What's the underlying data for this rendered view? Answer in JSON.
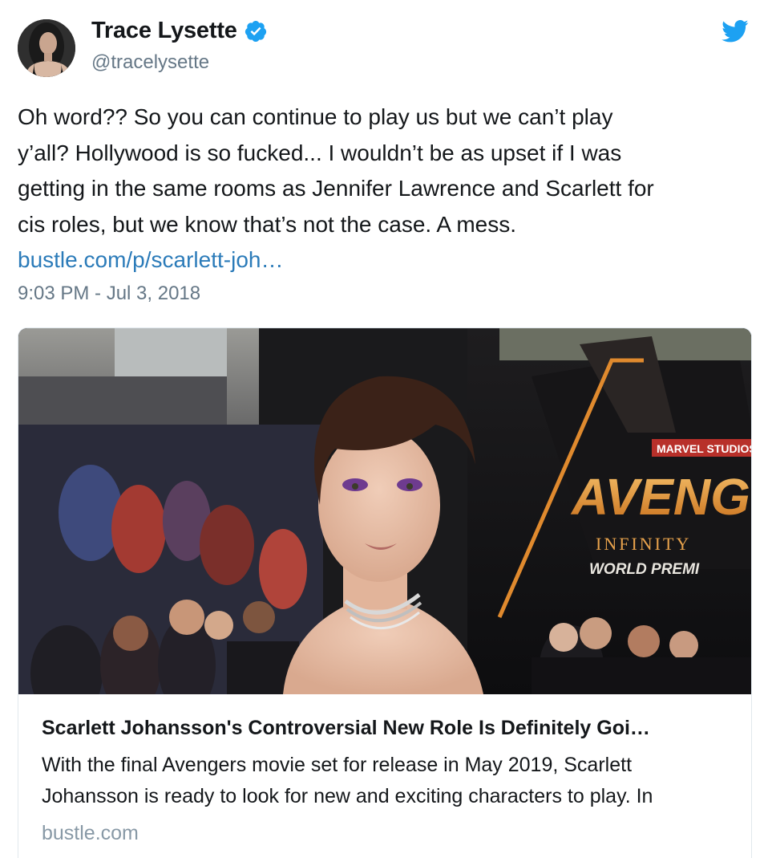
{
  "author": {
    "display_name": "Trace Lysette",
    "handle": "@tracelysette",
    "verified": true,
    "avatar_icon": "profile-photo"
  },
  "tweet": {
    "text": "Oh word?? So you can continue to play us but we can’t play\ny’all? Hollywood is so fucked... I wouldn’t be as upset if I was\ngetting in the same rooms as Jennifer Lawrence and Scarlett for\ncis roles, but we know that’s not the case. A mess.",
    "link": "bustle.com/p/scarlett-joh…",
    "timestamp": "9:03 PM - Jul 3, 2018"
  },
  "card": {
    "image_sign_brand": "MARVEL STUDIOS",
    "image_sign_title": "AVENG",
    "image_sign_sub": "INFINITY",
    "image_sign_premiere": "WORLD PREMI",
    "title": "Scarlett Johansson's Controversial New Role Is Definitely Goi…",
    "description": "With the final Avengers movie set for release in May 2019, Scarlett\nJohansson is ready to look for new and exciting characters to play. In",
    "domain": "bustle.com"
  },
  "colors": {
    "link": "#2b7bb9",
    "verified_badge": "#1da1f2",
    "twitter_bird": "#1da1f2",
    "secondary_text": "#657786"
  },
  "icons": {
    "verified": "verified-badge-icon",
    "brand": "twitter-bird-icon"
  }
}
